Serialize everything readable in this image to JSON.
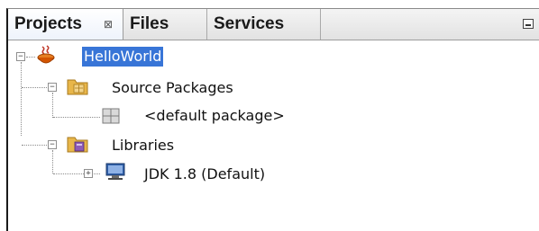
{
  "tabs": [
    {
      "label": "Projects",
      "active": true,
      "close_glyph": "⊠"
    },
    {
      "label": "Files",
      "active": false
    },
    {
      "label": "Services",
      "active": false
    }
  ],
  "window_controls": {
    "minimize_icon": "minimize-icon"
  },
  "tree": {
    "root": {
      "label": "HelloWorld",
      "expanded": true,
      "selected": true,
      "icon": "coffee-cup-icon"
    },
    "source_packages": {
      "label": "Source Packages",
      "expanded": true,
      "icon": "source-packages-folder-icon"
    },
    "default_package": {
      "label": "<default package>",
      "icon": "package-icon"
    },
    "libraries": {
      "label": "Libraries",
      "expanded": true,
      "icon": "libraries-folder-icon"
    },
    "jdk": {
      "label": "JDK 1.8 (Default)",
      "expanded": false,
      "icon": "jdk-platform-icon"
    }
  },
  "colors": {
    "selection": "#3875d7",
    "folder": "#e8b64a",
    "tab_gradient_top": "#f4f4f4",
    "tab_gradient_bottom": "#e2e2e2"
  }
}
